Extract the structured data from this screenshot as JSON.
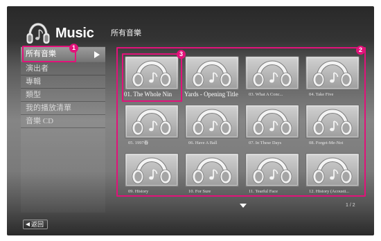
{
  "app": {
    "title": "Music",
    "logo_icon": "headphones-icon"
  },
  "page_title": "所有音樂",
  "sidebar": {
    "submenu_icon": "triangle-right-icon",
    "items": [
      {
        "label": "所有音樂",
        "selected": true
      },
      {
        "label": "演出者",
        "selected": false
      },
      {
        "label": "專輯",
        "selected": false
      },
      {
        "label": "類型",
        "selected": false
      },
      {
        "label": "我的播放清單",
        "selected": false
      },
      {
        "label": "音樂 CD",
        "selected": false
      }
    ]
  },
  "grid": {
    "item_icon": "headphones-icon",
    "items": [
      {
        "caption": "01. The Whole Nin",
        "selected": true
      },
      {
        "caption": "Yards - Opening Title",
        "selected": false
      },
      {
        "caption": "03. What A Conc...",
        "selected": false
      },
      {
        "caption": "04. Take Five",
        "selected": false
      },
      {
        "caption": "05. 1997春",
        "selected": false
      },
      {
        "caption": "06. Have A Ball",
        "selected": false
      },
      {
        "caption": "07. In These Days",
        "selected": false
      },
      {
        "caption": "08. Forget-Me-Not",
        "selected": false
      },
      {
        "caption": "09. History",
        "selected": false
      },
      {
        "caption": "10. For Sure",
        "selected": false
      },
      {
        "caption": "11. Tearful Face",
        "selected": false
      },
      {
        "caption": "12. History (Acousti...",
        "selected": false
      }
    ]
  },
  "pagination": {
    "label": "1 / 2",
    "next_icon": "triangle-down-icon"
  },
  "back_button": {
    "icon": "triangle-left-icon",
    "label": "返回"
  },
  "annotations": {
    "badges": [
      "1",
      "2",
      "3"
    ]
  },
  "colors": {
    "annotation": "#e2127a",
    "text": "#ffffff",
    "selected_row": "#8a8a8a"
  }
}
